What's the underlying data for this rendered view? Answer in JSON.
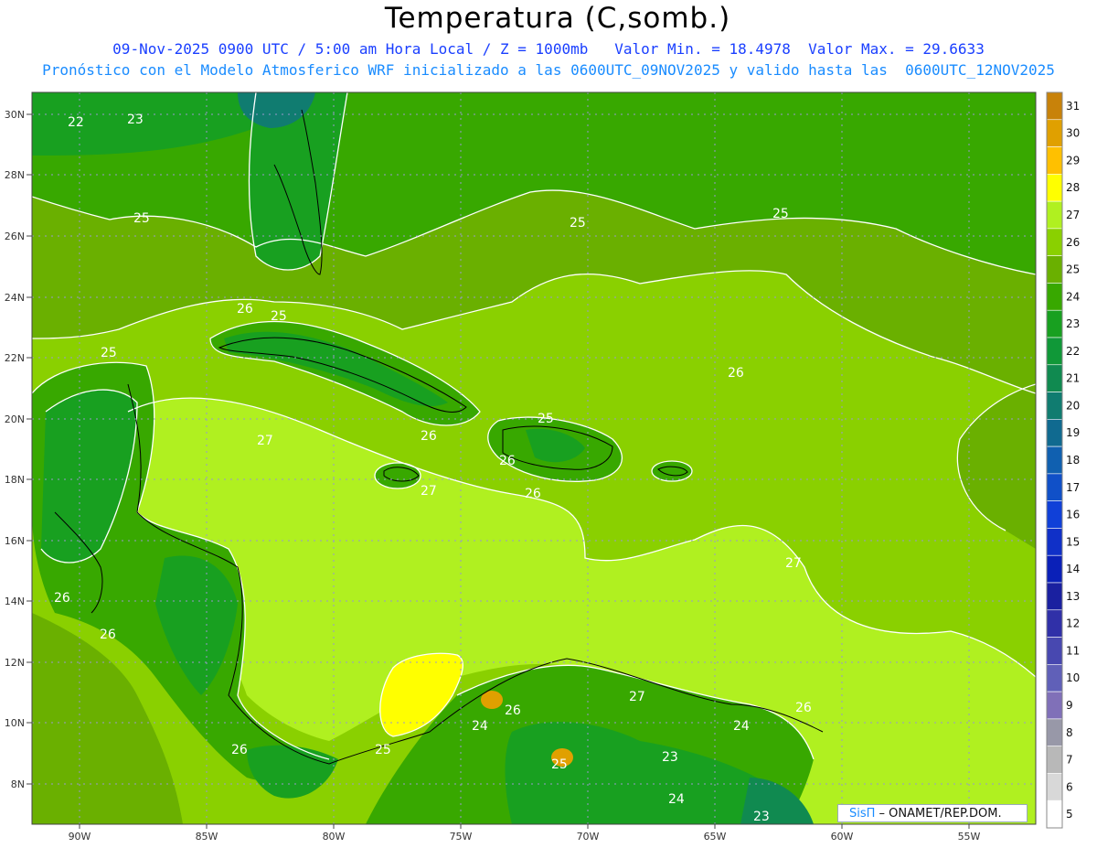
{
  "title": "Temperatura (C,somb.)",
  "subtitle_line1": "09-Nov-2025 0900 UTC / 5:00 am Hora Local / Z = 1000mb   Valor Min. = 18.4978  Valor Max. = 29.6633",
  "subtitle_line2": "Pronóstico con el Modelo Atmosferico WRF inicializado a las 0600UTC_09NOV2025 y valido hasta las  0600UTC_12NOV2025",
  "map": {
    "lon_labels": [
      "90W",
      "85W",
      "80W",
      "75W",
      "70W",
      "65W",
      "60W",
      "55W"
    ],
    "lat_labels": [
      "30N",
      "28N",
      "26N",
      "24N",
      "22N",
      "20N",
      "18N",
      "16N",
      "14N",
      "12N",
      "10N",
      "8N"
    ],
    "contour_labels": [
      "22",
      "23",
      "25",
      "25",
      "25",
      "25",
      "26",
      "25",
      "26",
      "26",
      "26",
      "27",
      "26",
      "25",
      "26",
      "26",
      "27",
      "27",
      "25",
      "26",
      "26",
      "27",
      "24",
      "26",
      "24",
      "23",
      "24",
      "23",
      "25"
    ],
    "credit": {
      "brand": "SisΠ",
      "text": " – ONAMET/REP.DOM."
    }
  },
  "colorbar": {
    "labels": [
      "31",
      "30",
      "29",
      "28",
      "27",
      "26",
      "25",
      "24",
      "23",
      "22",
      "21",
      "20",
      "19",
      "18",
      "17",
      "16",
      "15",
      "14",
      "13",
      "12",
      "11",
      "10",
      "9",
      "8",
      "7",
      "6",
      "5"
    ],
    "colors": [
      "#c8820a",
      "#e0a000",
      "#ffc000",
      "#ffff00",
      "#b0f020",
      "#8ad000",
      "#6ab000",
      "#38a800",
      "#18a020",
      "#109838",
      "#108a50",
      "#107c70",
      "#106a90",
      "#1060b0",
      "#1050c8",
      "#1040d8",
      "#1030c8",
      "#0a20b8",
      "#1a20a0",
      "#3030a8",
      "#4848b0",
      "#6060b8",
      "#8070b8",
      "#9898a8",
      "#b8b8b8",
      "#d8d8d8",
      "#ffffff"
    ]
  }
}
